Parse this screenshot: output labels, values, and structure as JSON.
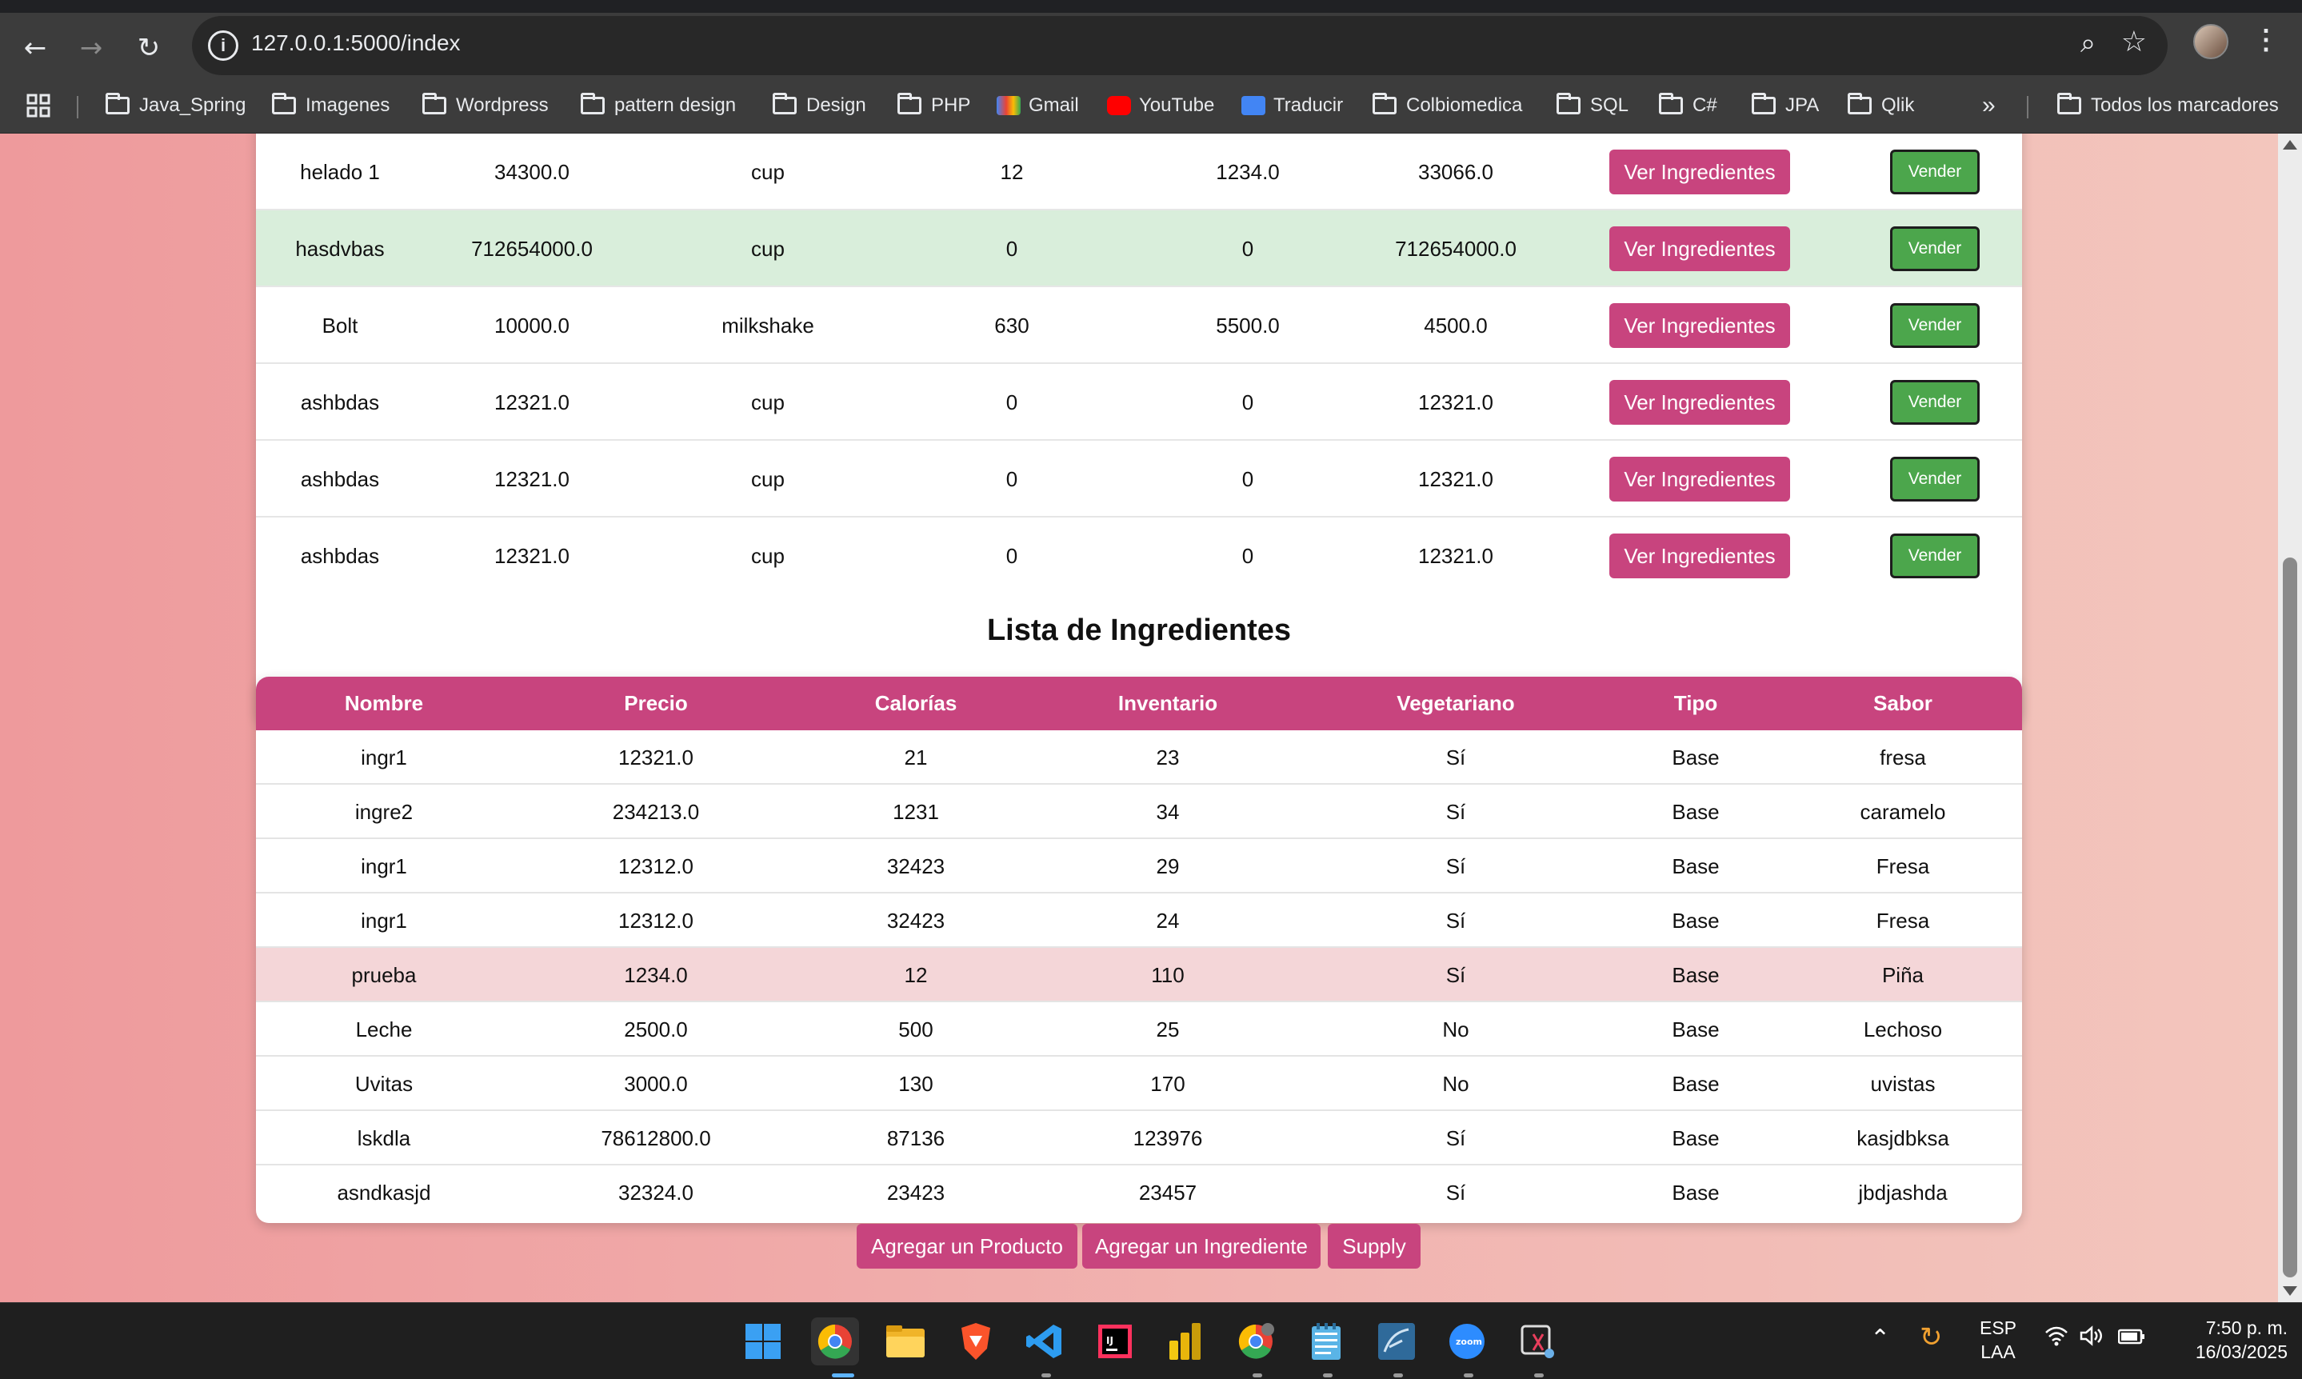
{
  "browser": {
    "url": "127.0.0.1:5000/index",
    "bookmarks": [
      "Java_Spring",
      "Imagenes",
      "Wordpress",
      "pattern design",
      "Design",
      "PHP",
      "Gmail",
      "YouTube",
      "Traducir",
      "Colbiomedica",
      "SQL",
      "C#",
      "JPA",
      "Qlik"
    ],
    "more": "»",
    "all_bookmarks": "Todos los marcadores"
  },
  "products": {
    "ver_label": "Ver Ingredientes",
    "vender_label": "Vender",
    "rows": [
      [
        "helado 1",
        "34300.0",
        "cup",
        "12",
        "1234.0",
        "33066.0"
      ],
      [
        "hasdvbas",
        "712654000.0",
        "cup",
        "0",
        "0",
        "712654000.0"
      ],
      [
        "Bolt",
        "10000.0",
        "milkshake",
        "630",
        "5500.0",
        "4500.0"
      ],
      [
        "ashbdas",
        "12321.0",
        "cup",
        "0",
        "0",
        "12321.0"
      ],
      [
        "ashbdas",
        "12321.0",
        "cup",
        "0",
        "0",
        "12321.0"
      ],
      [
        "ashbdas",
        "12321.0",
        "cup",
        "0",
        "0",
        "12321.0"
      ]
    ]
  },
  "ingredients": {
    "title": "Lista de Ingredientes",
    "headers": [
      "Nombre",
      "Precio",
      "Calorías",
      "Inventario",
      "Vegetariano",
      "Tipo",
      "Sabor"
    ],
    "rows": [
      [
        "ingr1",
        "12321.0",
        "21",
        "23",
        "Sí",
        "Base",
        "fresa"
      ],
      [
        "ingre2",
        "234213.0",
        "1231",
        "34",
        "Sí",
        "Base",
        "caramelo"
      ],
      [
        "ingr1",
        "12312.0",
        "32423",
        "29",
        "Sí",
        "Base",
        "Fresa"
      ],
      [
        "ingr1",
        "12312.0",
        "32423",
        "24",
        "Sí",
        "Base",
        "Fresa"
      ],
      [
        "prueba",
        "1234.0",
        "12",
        "110",
        "Sí",
        "Base",
        "Piña"
      ],
      [
        "Leche",
        "2500.0",
        "500",
        "25",
        "No",
        "Base",
        "Lechoso"
      ],
      [
        "Uvitas",
        "3000.0",
        "130",
        "170",
        "No",
        "Base",
        "uvistas"
      ],
      [
        "lskdla",
        "78612800.0",
        "87136",
        "123976",
        "Sí",
        "Base",
        "kasjdbksa"
      ],
      [
        "asndkasjd",
        "32324.0",
        "23423",
        "23457",
        "Sí",
        "Base",
        "jbdjashda"
      ]
    ]
  },
  "actions": {
    "add_product": "Agregar un Producto",
    "add_ingredient": "Agregar un Ingrediente",
    "supply": "Supply"
  },
  "taskbar": {
    "lang": "ESP",
    "layout": "LAA",
    "time": "7:50 p. m.",
    "date": "16/03/2025"
  },
  "colors": {
    "accent": "#c8447e",
    "sell": "#4ca64c",
    "row_highlight_green": "#d9eedb",
    "row_highlight_pink": "#f4d6d8"
  }
}
